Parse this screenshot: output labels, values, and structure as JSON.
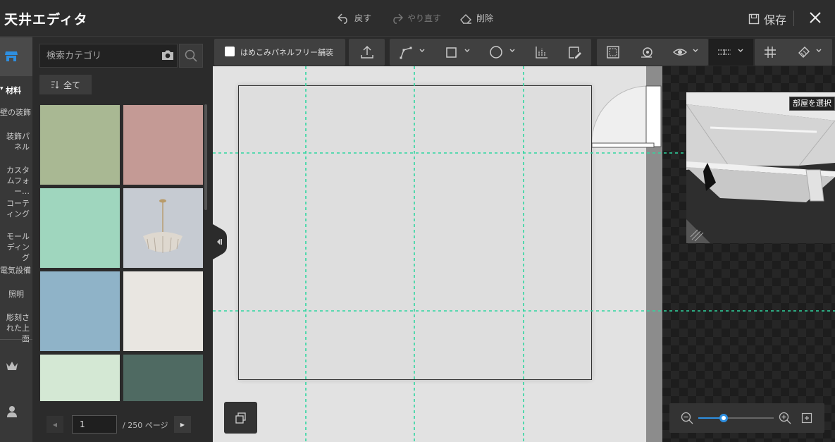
{
  "header": {
    "title": "天井エディタ",
    "undo_label": "戻す",
    "redo_label": "やり直す",
    "delete_label": "削除",
    "save_label": "保存"
  },
  "rail": {
    "category_label": "材料",
    "items": [
      "壁の装飾",
      "装飾パネル",
      "カスタムフォー…",
      "コーティング",
      "モールディング",
      "電気設備",
      "照明",
      "彫刻された上面"
    ]
  },
  "catalog": {
    "search_placeholder": "検索カテゴリ",
    "filter_label": "全て",
    "swatches": [
      {
        "name": "sage-green",
        "color": "#a9b893"
      },
      {
        "name": "dusty-rose",
        "color": "#c49a95"
      },
      {
        "name": "mint-texture",
        "color": "#9fd6be"
      },
      {
        "name": "chandelier",
        "color": "#c6cbd2"
      },
      {
        "name": "blue-linen",
        "color": "#8fb3c8"
      },
      {
        "name": "off-white",
        "color": "#e9e6e1"
      },
      {
        "name": "pale-green",
        "color": "#d4e8d4"
      },
      {
        "name": "dark-teal",
        "color": "#4f6a62"
      }
    ],
    "page_value": "1",
    "page_total": "/ 250 ページ"
  },
  "toolbar": {
    "fill_label": "はめこみパネルフリー舗装"
  },
  "preview": {
    "tooltip": "部屋を選択"
  },
  "colors": {
    "guide": "#2fd6a0",
    "accent": "#2e8fe0"
  }
}
